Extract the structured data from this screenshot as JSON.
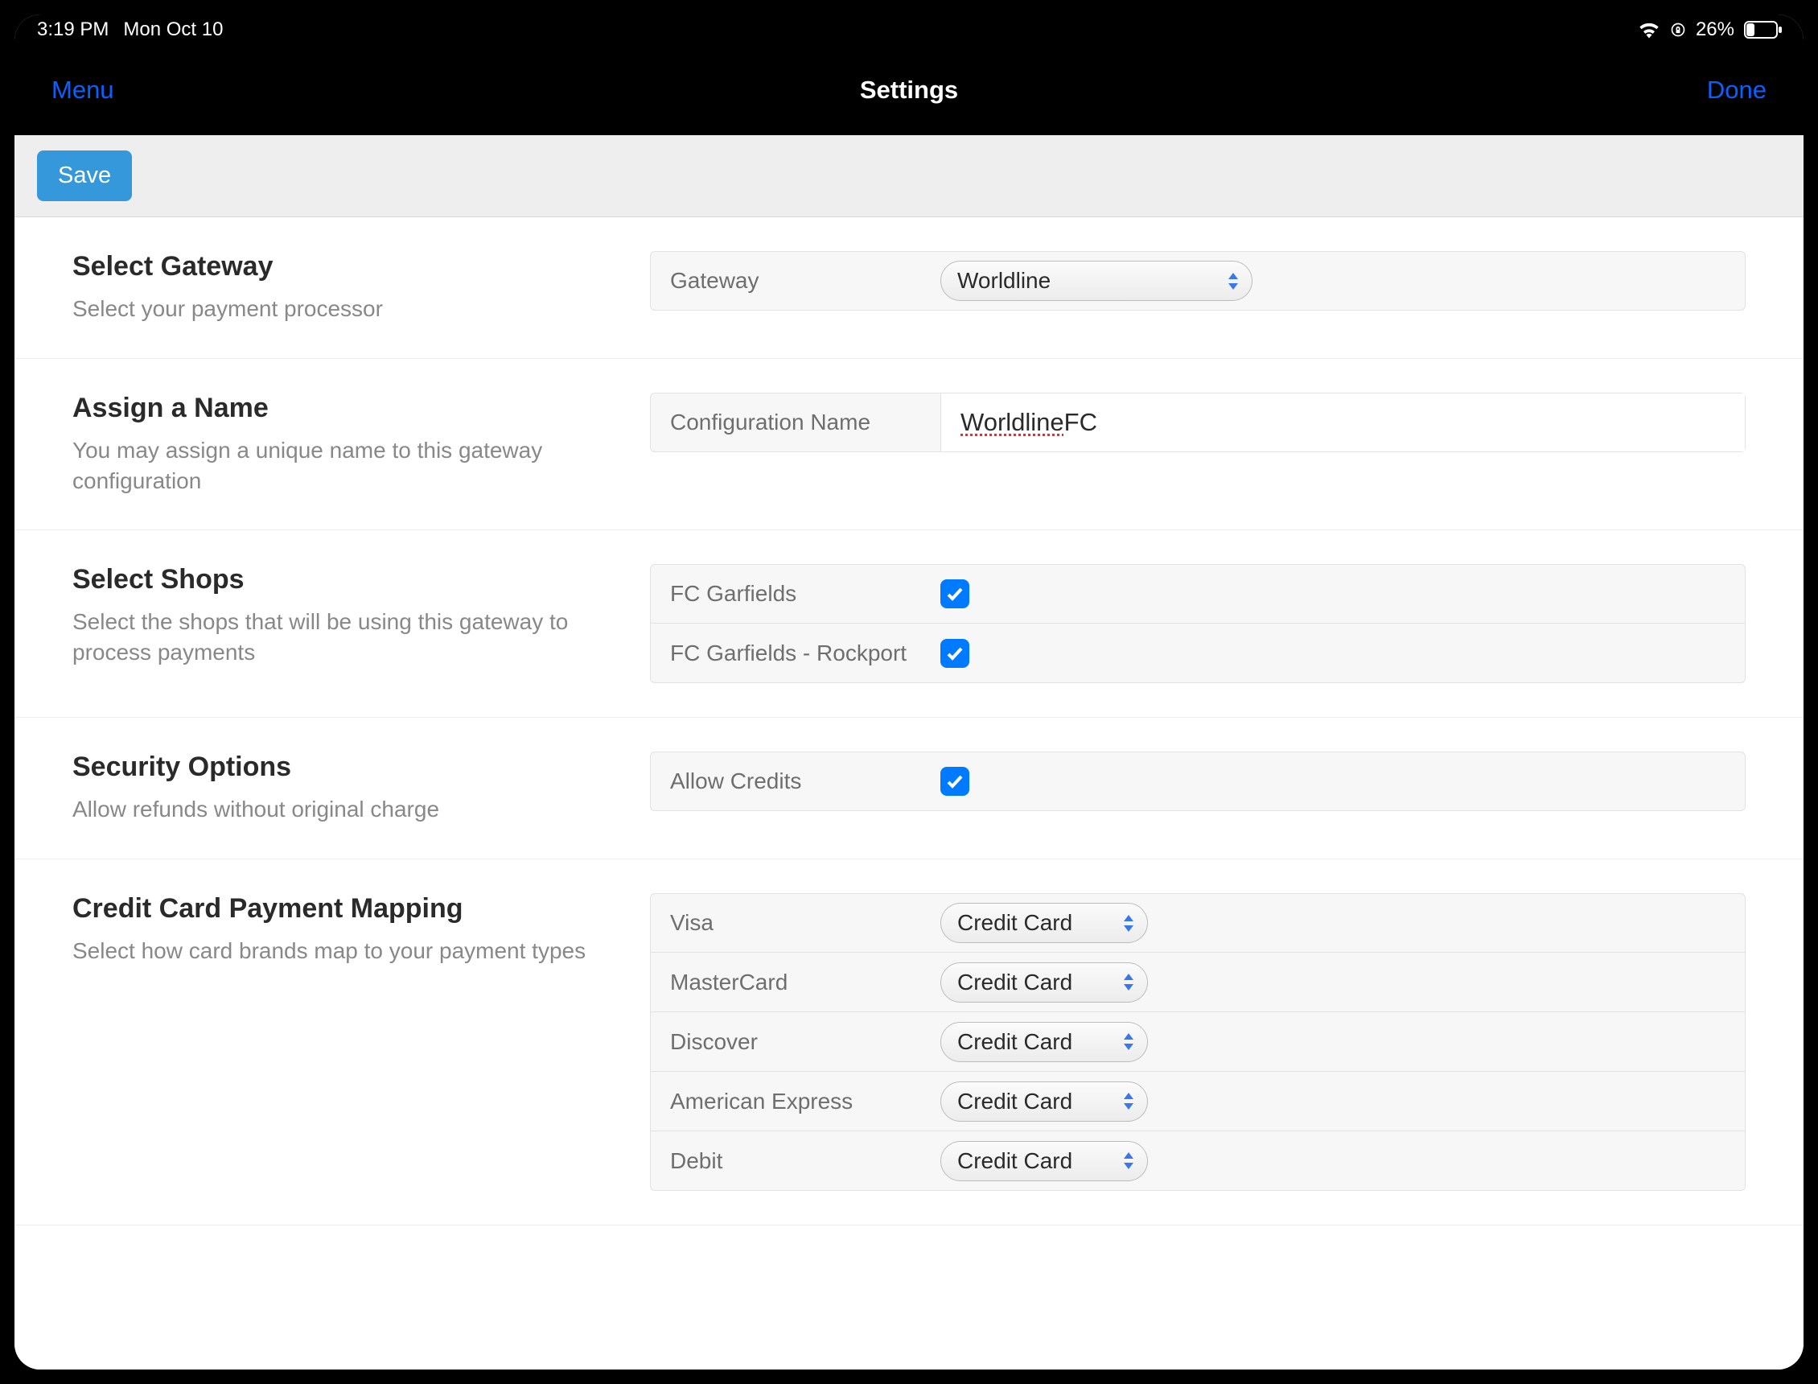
{
  "status": {
    "time": "3:19 PM",
    "date": "Mon Oct 10",
    "battery_percent": "26%"
  },
  "nav": {
    "menu_label": "Menu",
    "title": "Settings",
    "done_label": "Done"
  },
  "toolbar": {
    "save_label": "Save"
  },
  "sections": {
    "gateway": {
      "title": "Select Gateway",
      "desc": "Select your payment processor",
      "row_label": "Gateway",
      "value": "Worldline"
    },
    "name": {
      "title": "Assign a Name",
      "desc": "You may assign a unique name to this gateway configuration",
      "row_label": "Configuration Name",
      "value_spell": "Worldline",
      "value_rest": " FC"
    },
    "shops": {
      "title": "Select Shops",
      "desc": "Select the shops that will be using this gateway to process payments",
      "items": [
        {
          "label": "FC Garfields",
          "checked": true
        },
        {
          "label": "FC Garfields  - Rockport",
          "checked": true
        }
      ]
    },
    "security": {
      "title": "Security Options",
      "desc": "Allow refunds without original charge",
      "row_label": "Allow Credits",
      "checked": true
    },
    "mapping": {
      "title": "Credit Card Payment Mapping",
      "desc": "Select how card brands map to your payment types",
      "rows": [
        {
          "label": "Visa",
          "value": "Credit Card"
        },
        {
          "label": "MasterCard",
          "value": "Credit Card"
        },
        {
          "label": "Discover",
          "value": "Credit Card"
        },
        {
          "label": "American Express",
          "value": "Credit Card"
        },
        {
          "label": "Debit",
          "value": "Credit Card"
        }
      ]
    }
  }
}
